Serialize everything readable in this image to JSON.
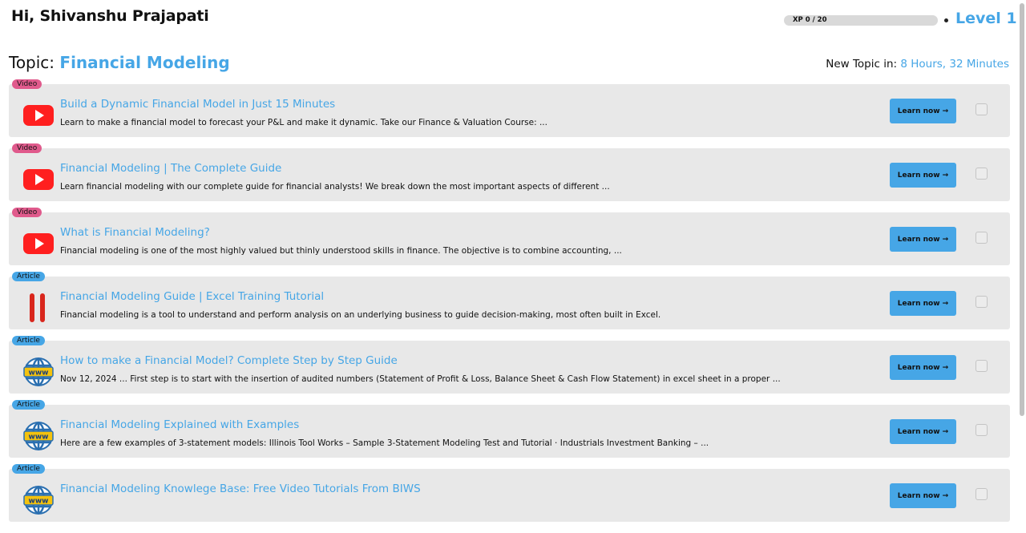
{
  "header": {
    "greeting": "Hi, Shivanshu Prajapati",
    "xp_text": "XP 0 / 20",
    "xp_fraction": 0,
    "level": "Level 1"
  },
  "topic": {
    "label": "Topic:",
    "value": "Financial Modeling",
    "new_label": "New Topic in:",
    "new_value": "8 Hours, 32 Minutes"
  },
  "colors": {
    "accent": "#46a6e6",
    "video_badge": "#e05a8c",
    "card_bg": "#e8e8e8"
  },
  "items": [
    {
      "badge": "Video",
      "kind": "video",
      "icon": "youtube-icon",
      "title": "Build a Dynamic Financial Model in Just 15 Minutes",
      "desc": "Learn to make a financial model to forecast your P&L and make it dynamic. Take our Finance & Valuation Course: ...",
      "button": "Learn now →"
    },
    {
      "badge": "Video",
      "kind": "video",
      "icon": "youtube-icon",
      "title": "Financial Modeling | The Complete Guide",
      "desc": "Learn financial modeling with our complete guide for financial analysts! We break down the most important aspects of different ...",
      "button": "Learn now →"
    },
    {
      "badge": "Video",
      "kind": "video",
      "icon": "youtube-icon",
      "title": "What is Financial Modeling?",
      "desc": "Financial modeling is one of the most highly valued but thinly understood skills in finance. The objective is to combine accounting, ...",
      "button": "Learn now →"
    },
    {
      "badge": "Article",
      "kind": "article",
      "icon": "site-logo-icon",
      "title": "Financial Modeling Guide | Excel Training Tutorial",
      "desc": "Financial modeling is a tool to understand and perform analysis on an underlying business to guide decision-making, most often built in Excel.",
      "button": "Learn now →"
    },
    {
      "badge": "Article",
      "kind": "article",
      "icon": "www-globe-icon",
      "title": "How to make a Financial Model? Complete Step by Step Guide",
      "desc": "Nov 12, 2024 ... First step is to start with the insertion of audited numbers (Statement of Profit & Loss, Balance Sheet & Cash Flow Statement) in excel sheet in a proper ...",
      "button": "Learn now →"
    },
    {
      "badge": "Article",
      "kind": "article",
      "icon": "www-globe-icon",
      "title": "Financial Modeling Explained with Examples",
      "desc": "Here are a few examples of 3-statement models: Illinois Tool Works – Sample 3-Statement Modeling Test and Tutorial · Industrials Investment Banking – ...",
      "button": "Learn now →"
    },
    {
      "badge": "Article",
      "kind": "article",
      "icon": "www-globe-icon",
      "title": "Financial Modeling Knowlege Base: Free Video Tutorials From BIWS",
      "desc": "",
      "button": "Learn now →"
    }
  ]
}
